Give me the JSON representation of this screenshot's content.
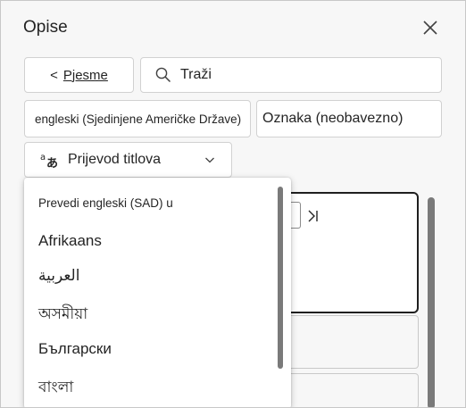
{
  "panel": {
    "title": "Opise",
    "back_label": "Pjesme",
    "back_arrow": "<",
    "search_placeholder": "Traži",
    "language_value": "engleski (Sjedinjene Američke Države)",
    "label_value": "Oznaka (neobavezno)",
    "translate_label": "Prijevod titlova"
  },
  "dropdown": {
    "header": "Prevedi engleski (SAD) u",
    "items": [
      "Afrikaans",
      "العربية",
      "অসমীয়া",
      "Български",
      "বাংলা"
    ]
  },
  "icons": {
    "close": "close-icon",
    "search": "search-icon",
    "translate": "translate-icon",
    "chevron": "chevron-down-icon",
    "skip": "skip-forward-icon"
  },
  "colors": {
    "pane_bg": "#f7f7f7",
    "border": "#d1d1d1",
    "text": "#242424",
    "scrollbar": "#7a7a7a"
  }
}
